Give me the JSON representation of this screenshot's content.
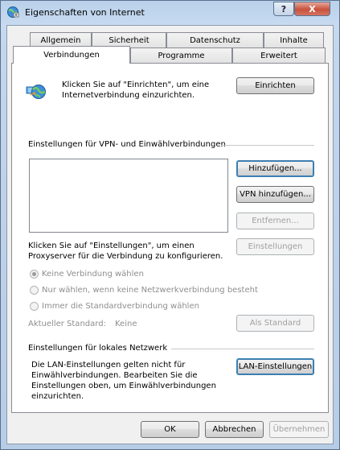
{
  "window": {
    "title": "Eigenschaften von Internet",
    "help_label": "?",
    "close_label": "X"
  },
  "tabs": {
    "row1": [
      "Allgemein",
      "Sicherheit",
      "Datenschutz",
      "Inhalte"
    ],
    "row2": [
      "Verbindungen",
      "Programme",
      "Erweitert"
    ],
    "active": "Verbindungen"
  },
  "setup": {
    "text_line1": "Klicken Sie auf \"Einrichten\", um eine",
    "text_line2": "Internetverbindung einzurichten.",
    "button": "Einrichten"
  },
  "vpn": {
    "heading": "Einstellungen für VPN- und Einwählverbindungen",
    "add_button": "Hinzufügen...",
    "add_vpn_button": "VPN hinzufügen...",
    "remove_button": "Entfernen...",
    "settings_text_line1": "Klicken Sie auf \"Einstellungen\", um einen",
    "settings_text_line2": "Proxyserver für die Verbindung zu konfigurieren.",
    "settings_button": "Einstellungen",
    "radio_options": [
      {
        "label": "Keine Verbindung wählen",
        "checked": true
      },
      {
        "label": "Nur wählen, wenn keine Netzwerkverbindung besteht",
        "checked": false
      },
      {
        "label": "Immer die Standardverbindung wählen",
        "checked": false
      }
    ],
    "current_default_label": "Aktueller Standard:",
    "current_default_value": "Keine",
    "default_button": "Als Standard"
  },
  "lan": {
    "heading": "Einstellungen für lokales Netzwerk",
    "text_line1": "Die LAN-Einstellungen gelten nicht für",
    "text_line2": "Einwählverbindungen. Bearbeiten Sie die",
    "text_line3": "Einstellungen oben, um Einwählverbindungen",
    "text_line4": "einzurichten.",
    "button": "LAN-Einstellungen"
  },
  "footer": {
    "ok": "OK",
    "cancel": "Abbrechen",
    "apply": "Übernehmen"
  }
}
